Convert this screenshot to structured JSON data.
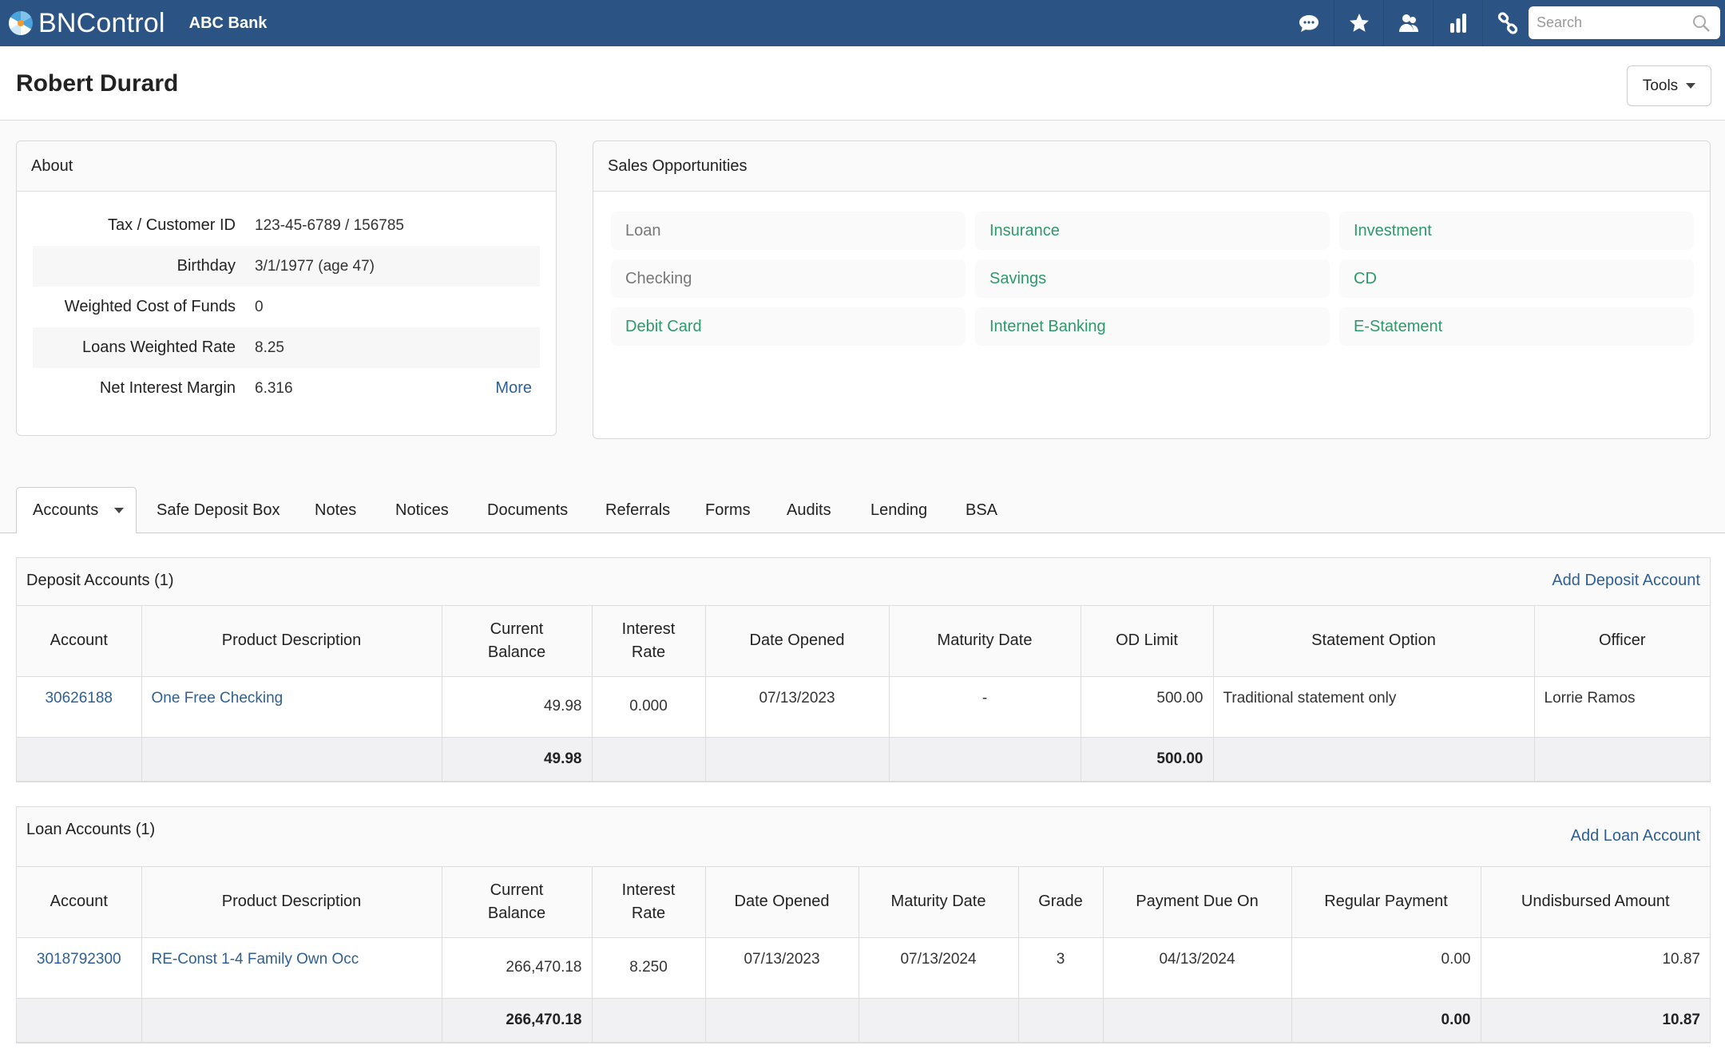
{
  "nav": {
    "brand": "BNControl",
    "bank": "ABC Bank",
    "icons": [
      "chat-icon",
      "star-icon",
      "users-icon",
      "bar-chart-icon",
      "link-icon"
    ],
    "search_placeholder": "Search"
  },
  "header": {
    "title": "Robert Durard",
    "tools_label": "Tools"
  },
  "about": {
    "title": "About",
    "rows": [
      {
        "label": "Tax / Customer ID",
        "value": "123-45-6789 / 156785"
      },
      {
        "label": "Birthday",
        "value": "3/1/1977 (age 47)"
      },
      {
        "label": "Weighted Cost of Funds",
        "value": "0"
      },
      {
        "label": "Loans Weighted Rate",
        "value": "8.25"
      },
      {
        "label": "Net Interest Margin",
        "value": "6.316"
      }
    ],
    "more_label": "More"
  },
  "sales": {
    "title": "Sales Opportunities",
    "items": [
      {
        "label": "Loan",
        "active": false
      },
      {
        "label": "Insurance",
        "active": true
      },
      {
        "label": "Investment",
        "active": true
      },
      {
        "label": "Checking",
        "active": false
      },
      {
        "label": "Savings",
        "active": true
      },
      {
        "label": "CD",
        "active": true
      },
      {
        "label": "Debit Card",
        "active": true
      },
      {
        "label": "Internet Banking",
        "active": true
      },
      {
        "label": "E-Statement",
        "active": true
      }
    ],
    "colors": {
      "active": "#2c9a6a",
      "inactive": "#777777"
    }
  },
  "tabs": [
    {
      "label": "Accounts",
      "active": true
    },
    {
      "label": "Safe Deposit Box"
    },
    {
      "label": "Notes"
    },
    {
      "label": "Notices"
    },
    {
      "label": "Documents"
    },
    {
      "label": "Referrals"
    },
    {
      "label": "Forms"
    },
    {
      "label": "Audits"
    },
    {
      "label": "Lending"
    },
    {
      "label": "BSA"
    }
  ],
  "deposit": {
    "title": "Deposit Accounts (1)",
    "action": "Add Deposit Account",
    "columns": [
      "Account",
      "Product Description",
      "Current Balance",
      "Interest Rate",
      "Date Opened",
      "Maturity Date",
      "OD Limit",
      "Statement Option",
      "Officer"
    ],
    "rows": [
      {
        "account": "30626188",
        "product": "One Free Checking",
        "balance": "49.98",
        "rate": "0.000",
        "opened": "07/13/2023",
        "maturity": "-",
        "od_limit": "500.00",
        "statement": "Traditional statement only",
        "officer": "Lorrie Ramos"
      }
    ],
    "totals": {
      "balance": "49.98",
      "od_limit": "500.00"
    }
  },
  "loan": {
    "title": "Loan Accounts (1)",
    "action": "Add Loan Account",
    "columns": [
      "Account",
      "Product Description",
      "Current Balance",
      "Interest Rate",
      "Date Opened",
      "Maturity Date",
      "Grade",
      "Payment Due On",
      "Regular Payment",
      "Undisbursed Amount"
    ],
    "rows": [
      {
        "account": "3018792300",
        "product": "RE-Const 1-4 Family Own Occ",
        "balance": "266,470.18",
        "rate": "8.250",
        "opened": "07/13/2023",
        "maturity": "07/13/2024",
        "grade": "3",
        "due": "04/13/2024",
        "payment": "0.00",
        "undisbursed": "10.87"
      }
    ],
    "totals": {
      "balance": "266,470.18",
      "payment": "0.00",
      "undisbursed": "10.87"
    }
  },
  "colors": {
    "nav": "#2b5485",
    "link": "#2f5f93",
    "accent_green": "#2c9a6a"
  }
}
